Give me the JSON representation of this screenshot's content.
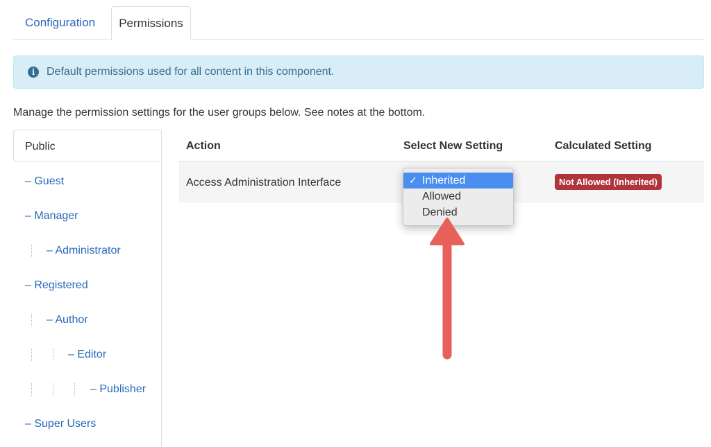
{
  "tabs": [
    {
      "label": "Configuration"
    },
    {
      "label": "Permissions"
    }
  ],
  "alert": {
    "icon": "info-icon",
    "text": "Default permissions used for all content in this component."
  },
  "instructions": "Manage the permission settings for the user groups below. See notes at the bottom.",
  "groups": {
    "selected": "Public",
    "items": [
      {
        "label": "– Guest"
      },
      {
        "label": "– Manager"
      },
      {
        "label": "– Administrator"
      },
      {
        "label": "– Registered"
      },
      {
        "label": "– Author"
      },
      {
        "label": "– Editor"
      },
      {
        "label": "– Publisher"
      },
      {
        "label": "– Super Users"
      }
    ]
  },
  "table": {
    "headers": {
      "action": "Action",
      "select": "Select New Setting",
      "calculated": "Calculated Setting"
    },
    "rows": [
      {
        "action": "Access Administration Interface",
        "calculated": "Not Allowed (Inherited)"
      }
    ]
  },
  "dropdown": {
    "check": "✓",
    "options": [
      {
        "label": "Inherited",
        "selected": true
      },
      {
        "label": "Allowed",
        "selected": false
      },
      {
        "label": "Denied",
        "selected": false
      }
    ]
  },
  "colors": {
    "link": "#2a69b8",
    "badge": "#b0343a",
    "arrow": "#e8605a",
    "highlight": "#4a8ff0"
  }
}
